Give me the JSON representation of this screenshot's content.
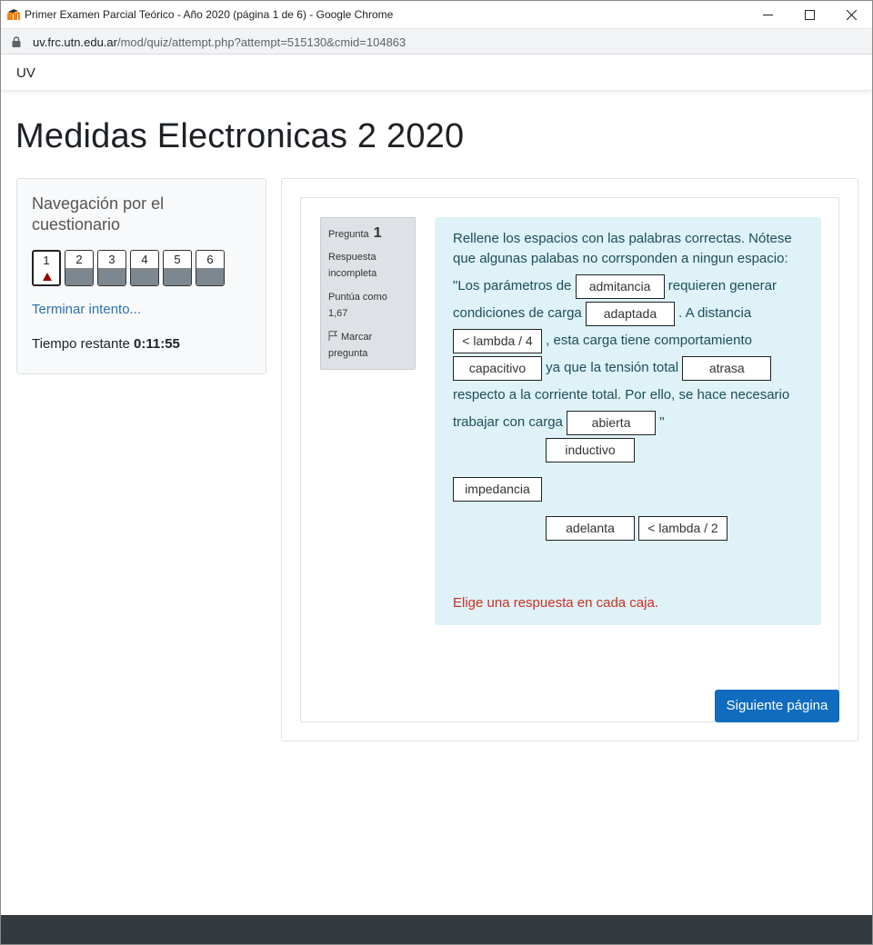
{
  "window": {
    "title": "Primer Examen Parcial Teórico - Año 2020 (página 1 de 6) - Google Chrome"
  },
  "address": {
    "host": "uv.frc.utn.edu.ar",
    "path": "/mod/quiz/attempt.php?attempt=515130&cmid=104863"
  },
  "navbar": {
    "brand": "UV"
  },
  "page": {
    "heading": "Medidas Electronicas 2 2020"
  },
  "quiz_nav": {
    "title": "Navegación por el cuestionario",
    "questions": [
      "1",
      "2",
      "3",
      "4",
      "5",
      "6"
    ],
    "current": "1",
    "finish_link": "Terminar intento...",
    "timer_label": "Tiempo restante",
    "timer_value": "0:11:55"
  },
  "question": {
    "number_label": "Pregunta",
    "number": "1",
    "state": "Respuesta incompleta",
    "grade": "Puntúa como 1,67",
    "flag_label": "Marcar pregunta",
    "prompt": "Rellene los espacios con las palabras correctas. Nótese que algunas palabas no corrsponden a ningun espacio:",
    "text": {
      "t1": "\"Los parámetros de",
      "t2": "requieren generar condiciones de carga",
      "t3": ". A distancia",
      "t4": ", esta carga tiene comportamiento",
      "t5": "ya que la tensión total",
      "t6": "respecto a la corriente total. Por ello, se hace necesario trabajar con carga",
      "t7": "\""
    },
    "drops": [
      "admitancia",
      "adaptada",
      "< lambda / 4",
      "capacitivo",
      "atrasa",
      "abierta"
    ],
    "choices": [
      "inductivo",
      "impedancia",
      "adelanta",
      "< lambda / 2"
    ],
    "validation": "Elige una respuesta en cada caja."
  },
  "buttons": {
    "next": "Siguiente página"
  },
  "colors": {
    "accent": "#0f6cbf",
    "link": "#2a73b0",
    "formulation_bg": "#def2f8",
    "error": "#ca3120",
    "footer": "#343a40"
  }
}
